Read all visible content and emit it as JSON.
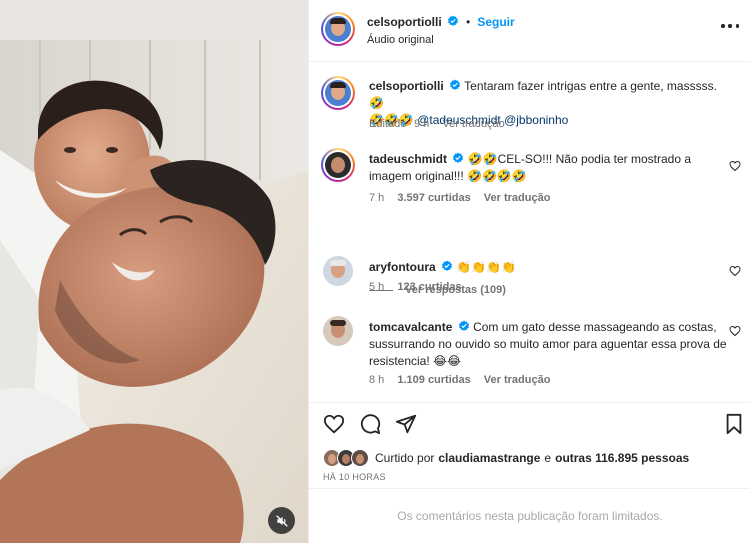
{
  "header": {
    "username": "celsoportiolli",
    "follow_label": "Seguir",
    "audio_label": "Áudio original",
    "more_icon": "more-options-icon"
  },
  "caption": {
    "username": "celsoportiolli",
    "text_line1": "Tentaram fazer intrigas entre a gente, masssss. 🤣",
    "text_line2_emoji": "🤣🤣🤣",
    "mention1": "@tadeuschmidt",
    "mention2": "@jbboninho",
    "edited_label": "Editado",
    "time": "9 h",
    "translate_label": "Ver tradução"
  },
  "comments": [
    {
      "username": "tadeuschmidt",
      "text": "🤣🤣CEL-SO!!! Não podia ter mostrado a imagem original!!! 🤣🤣🤣🤣",
      "time": "7 h",
      "likes": "3.597 curtidas",
      "translate_label": "Ver tradução",
      "replies_label": "Ver respostas (109)"
    },
    {
      "username": "aryfontoura",
      "text": "👏👏👏👏",
      "time": "5 h",
      "likes": "123 curtidas"
    },
    {
      "username": "tomcavalcante",
      "text": "Com um gato desse massageando as costas, sussurrando no ouvido so muito amor para aguentar essa prova de resistencia! 😂😂",
      "time": "8 h",
      "likes": "1.109 curtidas",
      "translate_label": "Ver tradução"
    }
  ],
  "actions": {
    "icons": [
      "heart-icon",
      "comment-icon",
      "share-icon",
      "bookmark-icon"
    ]
  },
  "likes_summary": {
    "prefix": "Curtido por",
    "user": "claudiamastrange",
    "middle": "e",
    "others": "outras 116.895 pessoas"
  },
  "timestamp": "HÁ 10 HORAS",
  "comments_limited": "Os comentários nesta publicação foram limitados.",
  "colors": {
    "accent": "#0095f6",
    "verified": "#0095f6",
    "muted_text": "#737373",
    "mention": "#00376b"
  }
}
